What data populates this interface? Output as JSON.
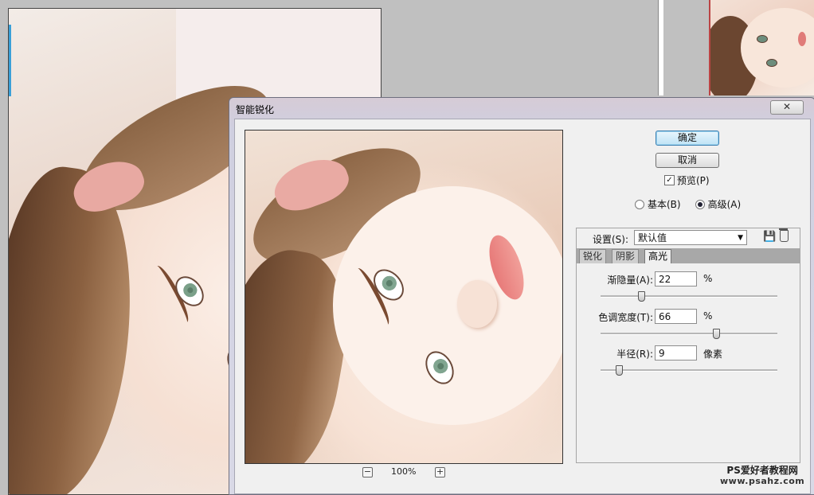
{
  "dialog": {
    "title": "智能锐化",
    "close_glyph": "✕",
    "ok_label": "确定",
    "cancel_label": "取消",
    "preview_label": "预览(P)",
    "preview_checked": true,
    "mode_basic": "基本(B)",
    "mode_advanced": "高级(A)",
    "selected_mode": "advanced",
    "zoom_level": "100%",
    "zoom_minus": "−",
    "zoom_plus": "+"
  },
  "settings": {
    "label": "设置(S):",
    "value": "默认值",
    "tabs": [
      "锐化",
      "阴影",
      "高光"
    ],
    "active_tab": "高光"
  },
  "fields": {
    "fade_amount": {
      "label": "渐隐量(A):",
      "value": "22",
      "unit": "%"
    },
    "tonal_width": {
      "label": "色调宽度(T):",
      "value": "66",
      "unit": "%"
    },
    "radius": {
      "label": "半径(R):",
      "value": "9",
      "unit": "像素"
    }
  },
  "sliders": {
    "fade_amount_fraction": 0.22,
    "tonal_width_fraction": 0.66,
    "radius_fraction": 0.09
  },
  "watermark": {
    "line1": "PS爱好者教程网",
    "line2": "www.psahz.com"
  },
  "colors": {
    "ok_button": "#bfe3f6",
    "tab_strip": "#a8a8a8"
  }
}
